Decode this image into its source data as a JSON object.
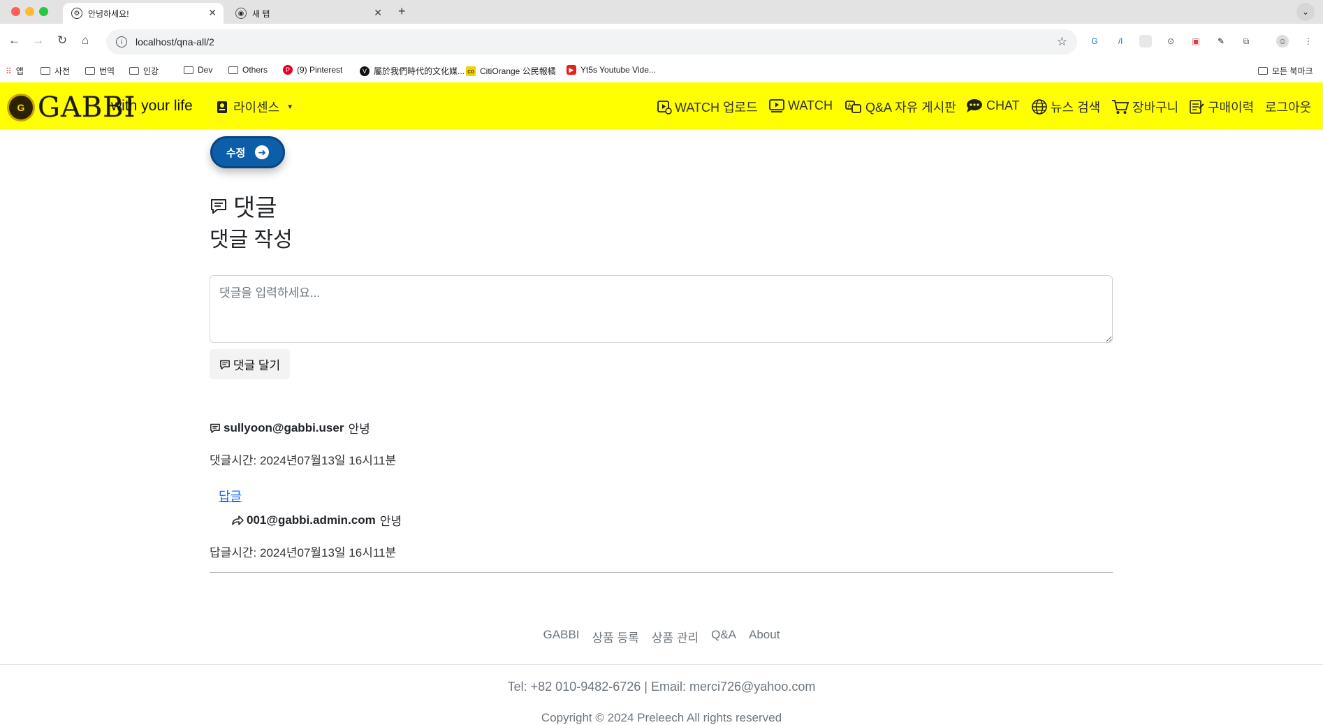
{
  "browser": {
    "tabs": [
      {
        "title": "안녕하세요!",
        "active": true
      },
      {
        "title": "새 탭",
        "active": false
      }
    ],
    "url": "localhost/qna-all/2",
    "bookmarks": [
      "앱",
      "사전",
      "번역",
      "인강",
      "Dev",
      "Others",
      "(9) Pinterest",
      "屬於我們時代的文化媒...",
      "CitiOrange 公民報橘",
      "Yt5s Youtube Vide..."
    ],
    "all_bookmarks": "모든 북마크"
  },
  "nav": {
    "logo_text": "GABBI",
    "tagline": "with your life",
    "license": "라이센스",
    "items": [
      "WATCH 업로드",
      "WATCH",
      "Q&A 자유 게시판",
      "CHAT",
      "뉴스 검색",
      "장바구니",
      "구매이력",
      "로그아웃"
    ]
  },
  "content": {
    "edit_button": "수정",
    "comments_title": "댓글",
    "write_title": "댓글 작성",
    "comment_placeholder": "댓글을 입력하세요...",
    "submit_button": "댓글 달기",
    "comment": {
      "author": "sullyoon@gabbi.user",
      "text": "안녕",
      "time": "댓글시간: 2024년07월13일 16시11분"
    },
    "reply_link": "답글",
    "reply": {
      "author": "001@gabbi.admin.com",
      "text": "안녕",
      "time": "답글시간: 2024년07월13일 16시11분"
    }
  },
  "footer": {
    "links": [
      "GABBI",
      "상품 등록",
      "상품 관리",
      "Q&A",
      "About"
    ],
    "contact": "Tel: +82 010-9482-6726 | Email: merci726@yahoo.com",
    "copyright": "Copyright © 2024 Preleech All rights reserved"
  },
  "colors": {
    "nav_bg": "#ffff00",
    "edit_button": "#0d5ea8",
    "link": "#0d6efd"
  }
}
